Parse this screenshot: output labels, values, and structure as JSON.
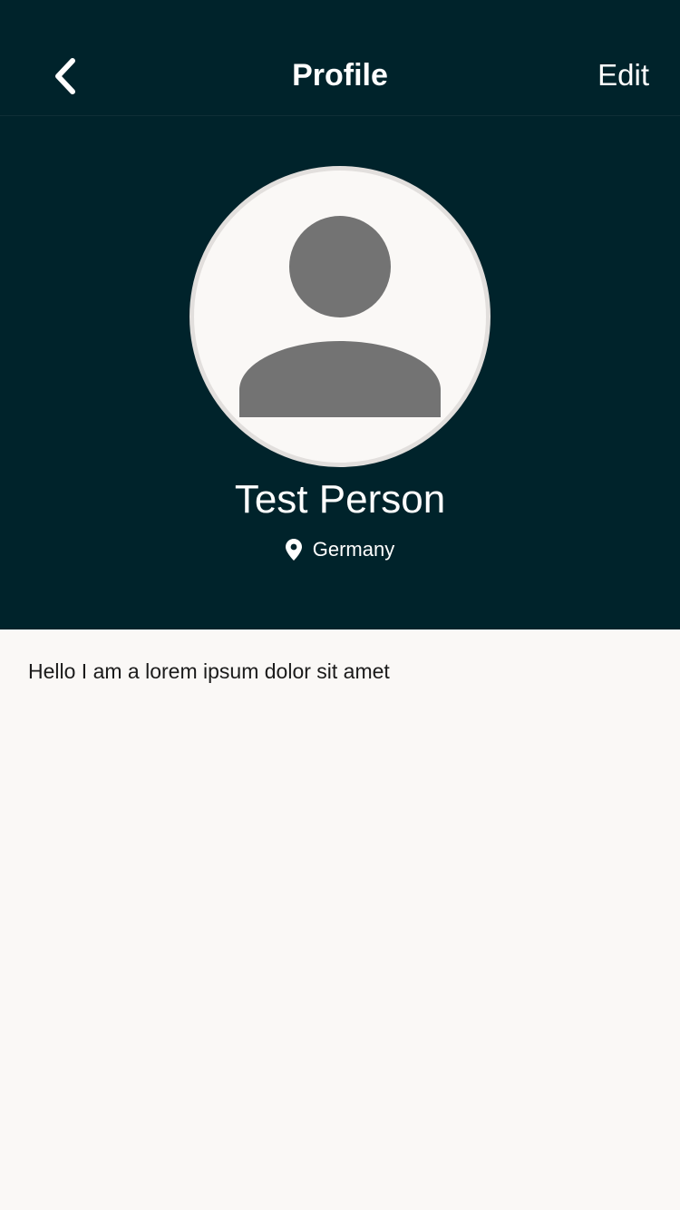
{
  "nav": {
    "back_icon": "chevron-left-icon",
    "title": "Profile",
    "edit_label": "Edit"
  },
  "profile": {
    "avatar_icon": "person-placeholder-icon",
    "name": "Test Person",
    "location_icon": "location-pin-icon",
    "location": "Germany",
    "bio": "Hello I am a lorem ipsum dolor sit amet"
  },
  "colors": {
    "header_bg": "#00232b",
    "page_bg": "#faf8f6",
    "avatar_ring": "#e2dfdd",
    "avatar_glyph": "#737373",
    "text_light": "#ffffff",
    "text_dark": "#1b1b1b"
  }
}
